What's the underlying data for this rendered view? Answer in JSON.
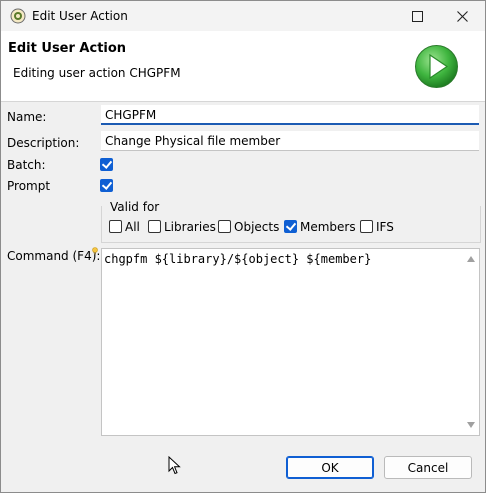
{
  "window": {
    "title": "Edit User Action",
    "icons": {
      "app": "eclipse-icon",
      "maximize": "maximize-icon",
      "close": "close-icon"
    }
  },
  "header": {
    "title": "Edit User Action",
    "subtitle": "Editing user action CHGPFM",
    "icon": "play-icon"
  },
  "form": {
    "name_label": "Name:",
    "name_value": "CHGPFM",
    "description_label": "Description:",
    "description_value": "Change Physical file member",
    "batch_label": "Batch:",
    "batch_checked": true,
    "prompt_label": "Prompt",
    "prompt_checked": true,
    "valid_for": {
      "title": "Valid for",
      "options": [
        {
          "label": "All",
          "checked": false
        },
        {
          "label": "Libraries",
          "checked": false
        },
        {
          "label": "Objects",
          "checked": false
        },
        {
          "label": "Members",
          "checked": true
        },
        {
          "label": "IFS",
          "checked": false
        }
      ]
    },
    "command_label": "Command (F4):",
    "command_value": "chgpfm ${library}/${object} ${member}"
  },
  "buttons": {
    "ok": "OK",
    "cancel": "Cancel"
  },
  "colors": {
    "accent": "#0f5fd3",
    "play_green": "#3fb53f"
  }
}
